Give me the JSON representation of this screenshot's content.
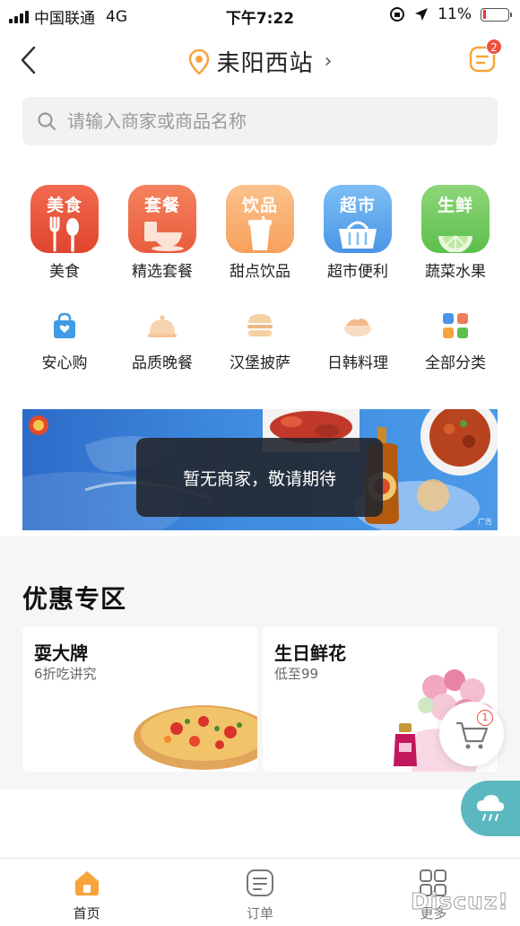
{
  "status": {
    "carrier": "中国联通",
    "network": "4G",
    "time": "下午7:22",
    "battery": "11%"
  },
  "header": {
    "location": "耒阳西站",
    "order_badge": "2"
  },
  "search": {
    "placeholder": "请输入商家或商品名称"
  },
  "categories_main": [
    {
      "tile_text": "美食",
      "label": "美食",
      "color_top": "#f26a4f",
      "color_bottom": "#e0452e"
    },
    {
      "tile_text": "套餐",
      "label": "精选套餐",
      "color_top": "#f5825e",
      "color_bottom": "#e85d3d"
    },
    {
      "tile_text": "饮品",
      "label": "甜点饮品",
      "color_top": "#fbc28d",
      "color_bottom": "#f7a05c"
    },
    {
      "tile_text": "超市",
      "label": "超市便利",
      "color_top": "#7dbef4",
      "color_bottom": "#4a95e6"
    },
    {
      "tile_text": "生鲜",
      "label": "蔬菜水果",
      "color_top": "#8fd67a",
      "color_bottom": "#5cbf4b"
    }
  ],
  "categories_secondary": [
    {
      "label": "安心购",
      "icon": "shopping-bag-icon"
    },
    {
      "label": "品质晚餐",
      "icon": "cloche-icon"
    },
    {
      "label": "汉堡披萨",
      "icon": "burger-icon"
    },
    {
      "label": "日韩料理",
      "icon": "sushi-icon"
    },
    {
      "label": "全部分类",
      "icon": "grid-icon"
    }
  ],
  "banner": {
    "toast": "暂无商家，敬请期待",
    "ad_tag": "广告"
  },
  "promo": {
    "title": "优惠专区",
    "cards": [
      {
        "name": "耍大牌",
        "subtitle": "6折吃讲究"
      },
      {
        "name": "生日鲜花",
        "subtitle": "低至99"
      }
    ]
  },
  "cart": {
    "badge": "1"
  },
  "tabs": [
    {
      "label": "首页",
      "icon": "home-icon",
      "active": true
    },
    {
      "label": "订单",
      "icon": "order-list-icon",
      "active": false
    },
    {
      "label": "更多",
      "icon": "more-grid-icon",
      "active": false
    }
  ],
  "watermark": "Discuz!",
  "colors": {
    "accent": "#f7a43a",
    "badge": "#f04e3e",
    "weather": "#5bb8c0"
  }
}
